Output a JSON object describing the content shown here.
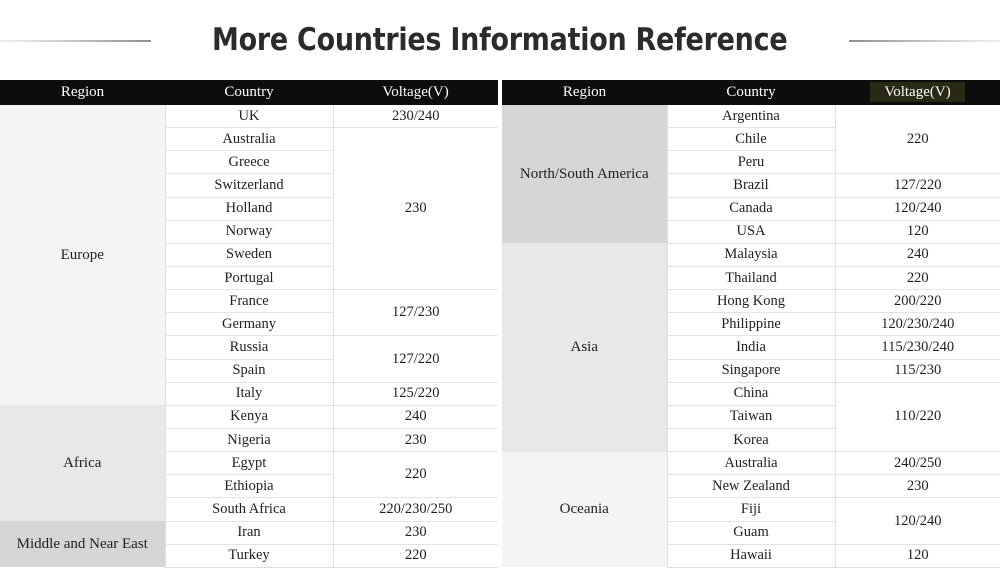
{
  "title": "More Countries Information Reference",
  "left_table": {
    "headers": {
      "region": "Region",
      "country": "Country",
      "voltage": "Voltage(V)"
    },
    "regions": [
      {
        "name": "Europe",
        "shade": "sh-1",
        "rows": 13
      },
      {
        "name": "Africa",
        "shade": "sh-2",
        "rows": 5
      },
      {
        "name": "Middle and Near East",
        "shade": "sh-3",
        "rows": 2
      }
    ],
    "countries": [
      "UK",
      "Australia",
      "Greece",
      "Switzerland",
      "Holland",
      "Norway",
      "Sweden",
      "Portugal",
      "France",
      "Germany",
      "Russia",
      "Spain",
      "Italy",
      "Kenya",
      "Nigeria",
      "Egypt",
      "Ethiopia",
      "South Africa",
      "Iran",
      "Turkey"
    ],
    "voltages": [
      {
        "value": "230/240",
        "rows": 1
      },
      {
        "value": "230",
        "rows": 7
      },
      {
        "value": "127/230",
        "rows": 2
      },
      {
        "value": "127/220",
        "rows": 2
      },
      {
        "value": "125/220",
        "rows": 1
      },
      {
        "value": "240",
        "rows": 1
      },
      {
        "value": "230",
        "rows": 1
      },
      {
        "value": "220",
        "rows": 2
      },
      {
        "value": "220/230/250",
        "rows": 1
      },
      {
        "value": "230",
        "rows": 1
      },
      {
        "value": "220",
        "rows": 1
      }
    ]
  },
  "right_table": {
    "headers": {
      "region": "Region",
      "country": "Country",
      "voltage": "Voltage(V)"
    },
    "regions": [
      {
        "name": "North/South America",
        "shade": "sh-3",
        "rows": 6
      },
      {
        "name": "Asia",
        "shade": "sh-2",
        "rows": 9
      },
      {
        "name": "Oceania",
        "shade": "sh-1",
        "rows": 5
      }
    ],
    "countries": [
      "Argentina",
      "Chile",
      "Peru",
      "Brazil",
      "Canada",
      "USA",
      "Malaysia",
      "Thailand",
      "Hong Kong",
      "Philippine",
      "India",
      "Singapore",
      "China",
      "Taiwan",
      "Korea",
      "Australia",
      "New Zealand",
      "Fiji",
      "Guam",
      "Hawaii"
    ],
    "voltages": [
      {
        "value": "220",
        "rows": 3
      },
      {
        "value": "127/220",
        "rows": 1
      },
      {
        "value": "120/240",
        "rows": 1
      },
      {
        "value": "120",
        "rows": 1
      },
      {
        "value": "240",
        "rows": 1
      },
      {
        "value": "220",
        "rows": 1
      },
      {
        "value": "200/220",
        "rows": 1
      },
      {
        "value": "120/230/240",
        "rows": 1
      },
      {
        "value": "115/230/240",
        "rows": 1
      },
      {
        "value": "115/230",
        "rows": 1
      },
      {
        "value": "110/220",
        "rows": 3
      },
      {
        "value": "240/250",
        "rows": 1
      },
      {
        "value": "230",
        "rows": 1
      },
      {
        "value": "120/240",
        "rows": 2
      },
      {
        "value": "120",
        "rows": 1
      }
    ]
  },
  "colors": {
    "header_bg": "#0d0d0d",
    "header_text": "#ffffff",
    "voltage_highlight": "#2a2a14",
    "shade_light": "#f4f4f4",
    "shade_mid": "#e8e8e8",
    "shade_dark": "#d6d6d6",
    "title_text": "#2b2b2b"
  }
}
